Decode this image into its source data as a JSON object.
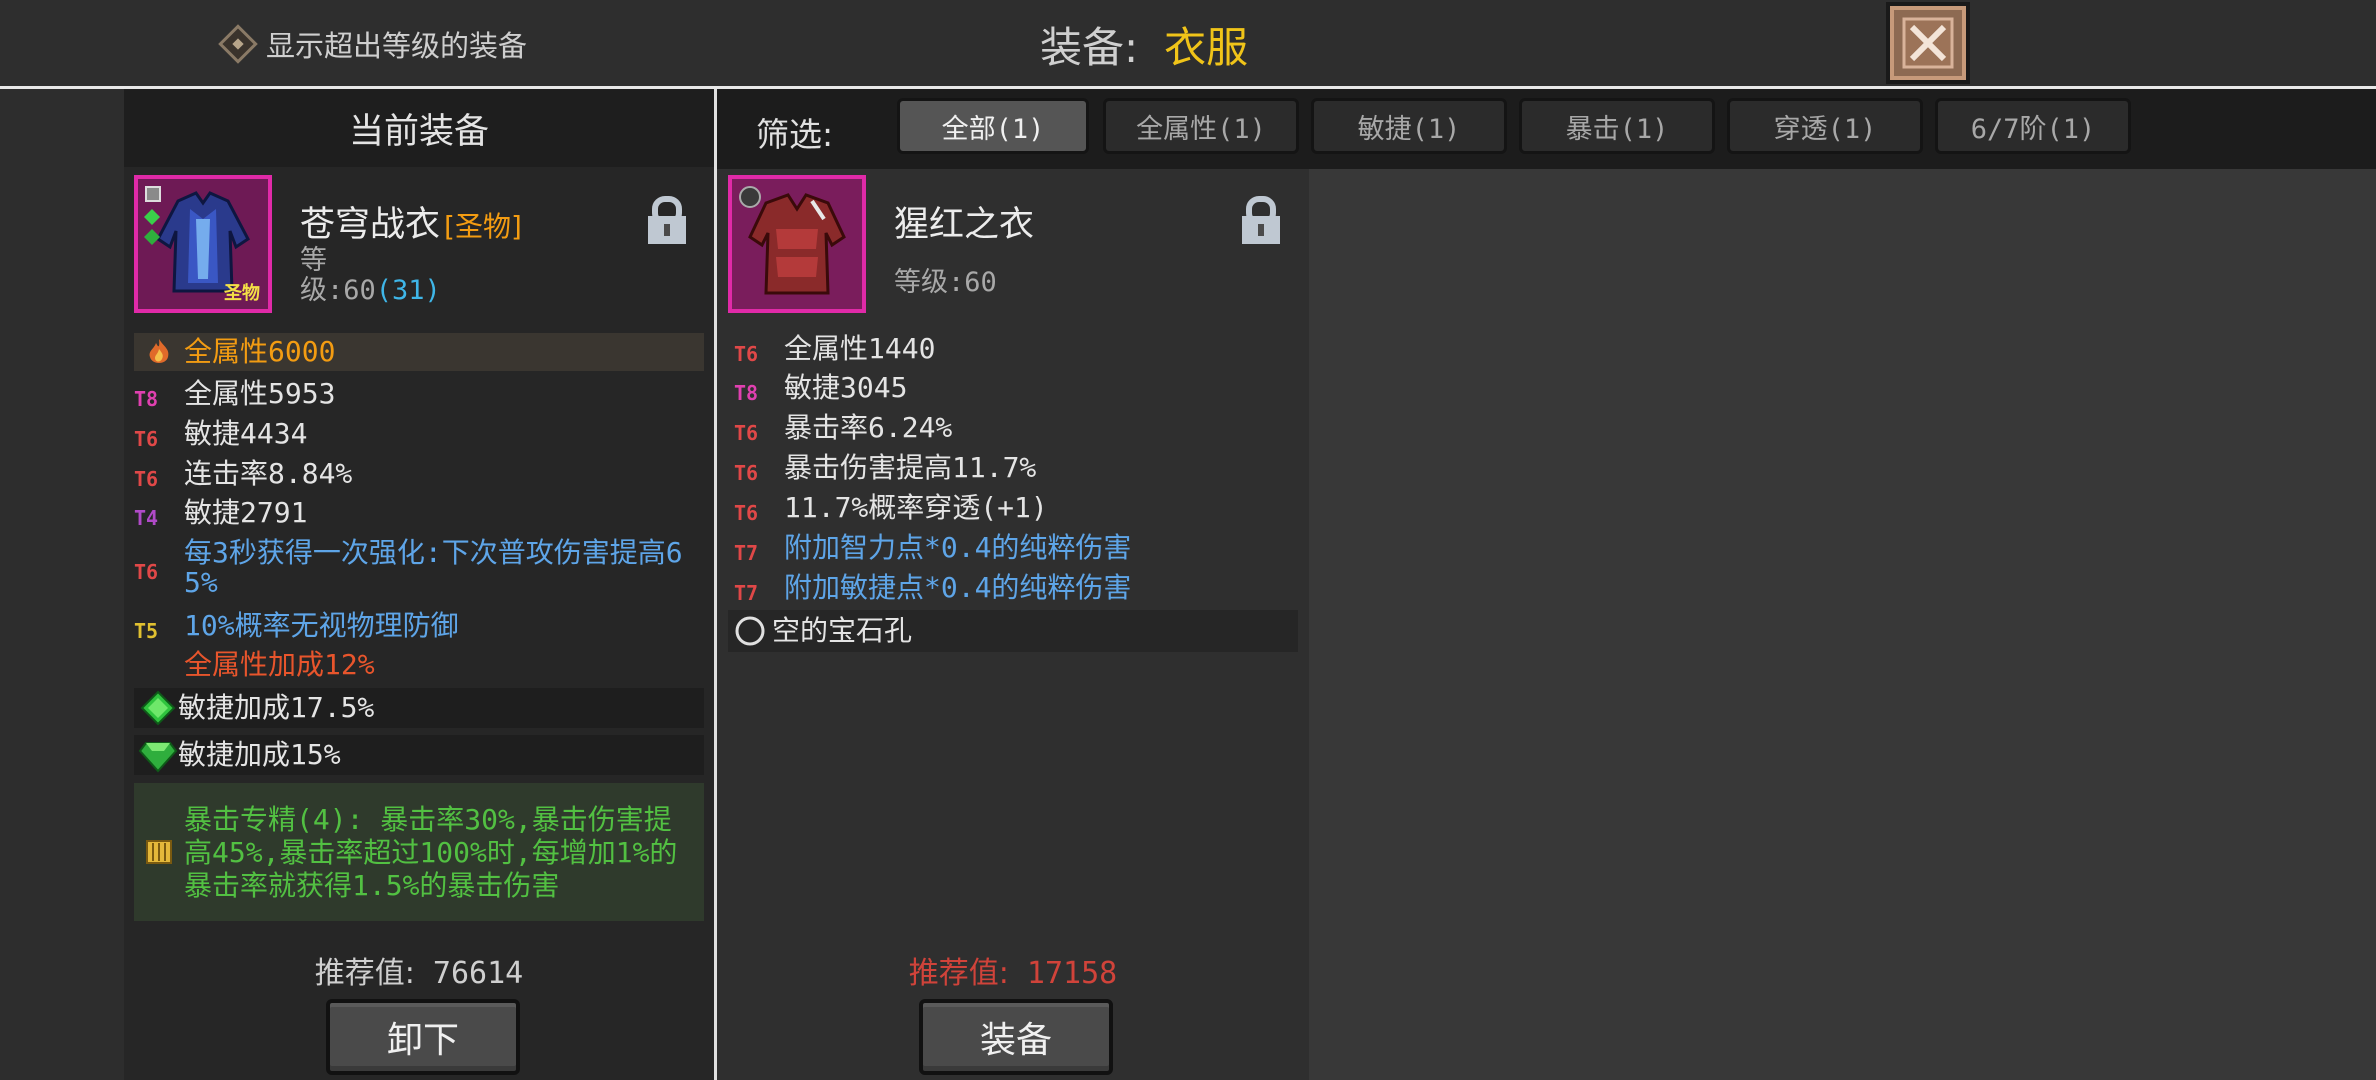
{
  "top": {
    "show_over_level_label": "显示超出等级的装备",
    "title_label": "装备:",
    "title_value": "衣服"
  },
  "current": {
    "header": "当前装备",
    "name": "苍穹战衣",
    "tag": "[圣物]",
    "level_prefix": "等",
    "level_line": "级:60",
    "level_bonus": "(31)",
    "icon_badge": "圣物",
    "stats": [
      {
        "tier": "",
        "text": "全属性6000",
        "color": "orn",
        "highlight": true
      },
      {
        "tier": "T8",
        "text": "全属性5953",
        "color": "wht"
      },
      {
        "tier": "T6",
        "text": "敏捷4434",
        "color": "wht"
      },
      {
        "tier": "T6",
        "text": "连击率8.84%",
        "color": "wht"
      },
      {
        "tier": "T4",
        "text": "敏捷2791",
        "color": "wht"
      },
      {
        "tier": "T6",
        "text": "每3秒获得一次强化:下次普攻伤害提高65%",
        "color": "blu"
      },
      {
        "tier": "T5",
        "text": "10%概率无视物理防御",
        "color": "blu"
      },
      {
        "tier": "",
        "text": "全属性加成12%",
        "color": "red"
      }
    ],
    "gems": [
      {
        "text": "敏捷加成17.5%"
      },
      {
        "text": "敏捷加成15%"
      }
    ],
    "set_bonus": "暴击专精(4): 暴击率30%,暴击伤害提高45%,暴击率超过100%时,每增加1%的暴击率就获得1.5%的暴击伤害",
    "recommend_label": "推荐值:",
    "recommend_value": "76614",
    "unequip_button": "卸下"
  },
  "filter": {
    "label": "筛选:",
    "tabs": [
      {
        "label": "全部(1)",
        "active": true
      },
      {
        "label": "全属性(1)",
        "active": false
      },
      {
        "label": "敏捷(1)",
        "active": false
      },
      {
        "label": "暴击(1)",
        "active": false
      },
      {
        "label": "穿透(1)",
        "active": false
      },
      {
        "label": "6/7阶(1)",
        "active": false
      }
    ]
  },
  "candidate": {
    "name": "猩红之衣",
    "level_line": "等级:60",
    "stats": [
      {
        "tier": "T6",
        "text": "全属性1440",
        "color": "wht"
      },
      {
        "tier": "T8",
        "text": "敏捷3045",
        "color": "wht"
      },
      {
        "tier": "T6",
        "text": "暴击率6.24%",
        "color": "wht"
      },
      {
        "tier": "T6",
        "text": "暴击伤害提高11.7%",
        "color": "wht"
      },
      {
        "tier": "T6",
        "text": "11.7%概率穿透(+1)",
        "color": "wht"
      },
      {
        "tier": "T7",
        "text": "附加智力点*0.4的纯粹伤害",
        "color": "blu"
      },
      {
        "tier": "T7",
        "text": "附加敏捷点*0.4的纯粹伤害",
        "color": "blu"
      }
    ],
    "empty_socket": "空的宝石孔",
    "recommend_label": "推荐值:",
    "recommend_value": "17158",
    "equip_button": "装备"
  },
  "colors": {
    "tier_T4": "#b04ac8",
    "tier_T5": "#e0c030",
    "tier_T6": "#e04848",
    "tier_T7": "#e04848",
    "tier_T8": "#e040b0",
    "title_accent": "#f0c419",
    "rarity_border": "#e02aa8"
  },
  "icons": [
    "diamond-checkbox-icon",
    "close-x-icon",
    "lock-icon",
    "armor-icon",
    "gem-icon",
    "scroll-icon",
    "socket-ring-icon"
  ]
}
